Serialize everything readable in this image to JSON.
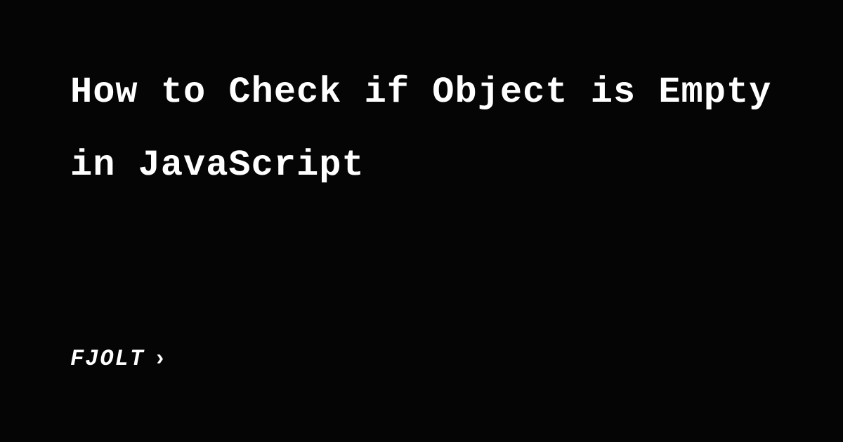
{
  "title": "How to Check if Object is Empty in JavaScript",
  "brand": {
    "name": "FJOLT",
    "chevron": "›"
  }
}
